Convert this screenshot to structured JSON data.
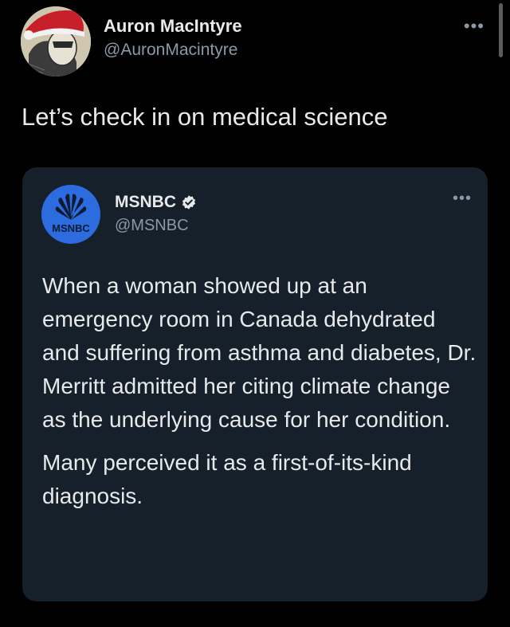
{
  "tweet": {
    "author_name": "Auron MacIntyre",
    "author_handle": "@AuronMacintyre",
    "more_label": "•••",
    "text": "Let’s check in on medical science"
  },
  "quote": {
    "author_name": "MSNBC",
    "author_handle": "@MSNBC",
    "avatar_label": "MSNBC",
    "more_label": "•••",
    "paragraphs": [
      "When a woman showed up at an emergency room in Canada dehydrated and suffering from asthma and diabetes, Dr. Merritt admitted her citing climate change as the underlying cause for her condition.",
      "Many perceived it as a first-of-its-kind diagnosis."
    ]
  },
  "colors": {
    "background": "#000000",
    "card": "#15202b",
    "text": "#e7e9ea",
    "muted": "#8b98a5",
    "msnbc_blue": "#2d6cdf"
  }
}
